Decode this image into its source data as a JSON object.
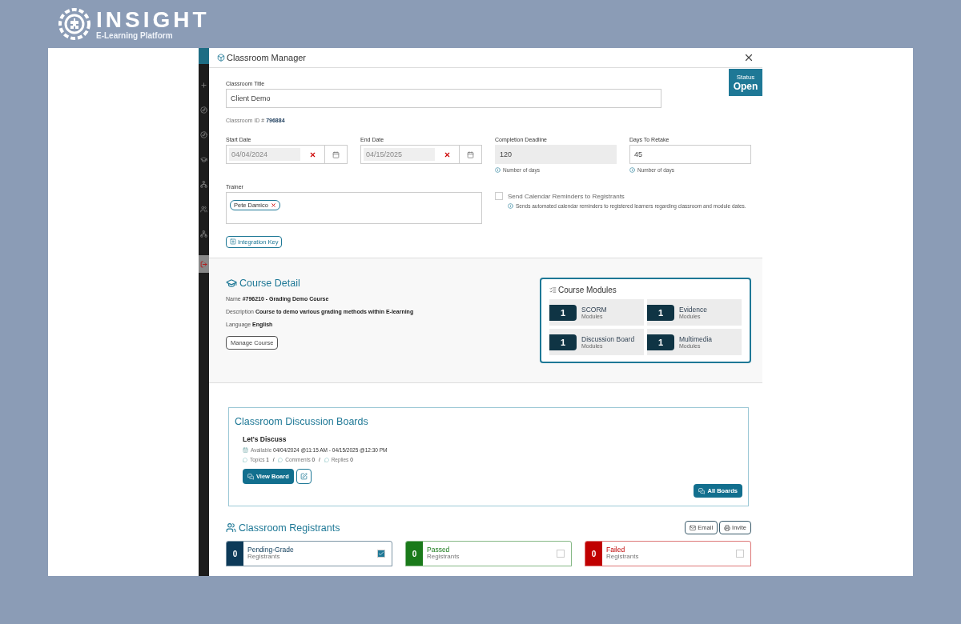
{
  "brand": {
    "name": "INSIGHT",
    "tagline": "E-Learning Platform"
  },
  "sidebar": {
    "items": [
      {
        "selected": false
      },
      {
        "selected": false
      },
      {
        "selected": false
      },
      {
        "selected": false
      },
      {
        "selected": false
      },
      {
        "selected": false
      },
      {
        "selected": false
      },
      {
        "selected": true
      }
    ]
  },
  "dialog": {
    "title": "Classroom Manager",
    "status_label": "Status",
    "status": "Open"
  },
  "form": {
    "title": {
      "label": "Classroom Title",
      "value": "Client Demo"
    },
    "classroom_id": {
      "label": "Classroom ID #",
      "value": "796884"
    },
    "dates": [
      {
        "label": "Start Date",
        "value": "04/04/2024",
        "disabled": true
      },
      {
        "label": "End Date",
        "value": "04/15/2025",
        "disabled": true
      }
    ],
    "numbers": [
      {
        "label": "Completion Deadline",
        "value": "120",
        "hint": "Number of days",
        "disabled": true
      },
      {
        "label": "Days To Retake",
        "value": "45",
        "hint": "Number of days",
        "disabled": false
      }
    ],
    "trainer": {
      "label": "Trainer",
      "chips": [
        "Pete Damico"
      ]
    },
    "calendar_reminders": {
      "label": "Send Calendar Reminders to Registrants",
      "checked": false,
      "hint": "Sends automated calendar reminders to registered learners regarding classroom and module dates."
    },
    "integration_key": "Integration Key"
  },
  "course_detail": {
    "title": "Course Detail",
    "fields": [
      {
        "label": "Name",
        "value": "#796210 - Grading Demo Course"
      },
      {
        "label": "Description",
        "value": "Course to demo various grading methods within E-learning"
      },
      {
        "label": "Language",
        "value": "English"
      }
    ],
    "button": "Manage Course"
  },
  "course_modules": {
    "title": "Course Modules",
    "items": [
      {
        "count": "1",
        "name": "SCORM",
        "sub": "Modules"
      },
      {
        "count": "1",
        "name": "Evidence",
        "sub": "Modules"
      },
      {
        "count": "1",
        "name": "Discussion Board",
        "sub": "Modules"
      },
      {
        "count": "1",
        "name": "Multimedia",
        "sub": "Modules"
      }
    ]
  },
  "discussion": {
    "title": "Classroom Discussion Boards",
    "boards": [
      {
        "name": "Let's Discuss",
        "available_label": "Available",
        "available": "04/04/2024 @11:15 AM - 04/15/2025 @12:30 PM",
        "stats": [
          {
            "label": "Topics",
            "value": "1"
          },
          {
            "label": "Comments",
            "value": "0"
          },
          {
            "label": "Replies",
            "value": "0"
          }
        ],
        "view_button": "View Board"
      }
    ],
    "stats_separator": "/",
    "all_button": "All Boards"
  },
  "registrants": {
    "title": "Classroom Registrants",
    "buttons": [
      "Email",
      "Invite"
    ],
    "groups": [
      {
        "count": "0",
        "name": "Pending-Grade",
        "sub": "Registrants",
        "color": "#0d3a58",
        "checked": true
      },
      {
        "count": "0",
        "name": "Passed",
        "sub": "Registrants",
        "color": "#1a7a1a",
        "checked": false
      },
      {
        "count": "0",
        "name": "Failed",
        "sub": "Registrants",
        "color": "#c00000",
        "checked": false
      }
    ]
  }
}
